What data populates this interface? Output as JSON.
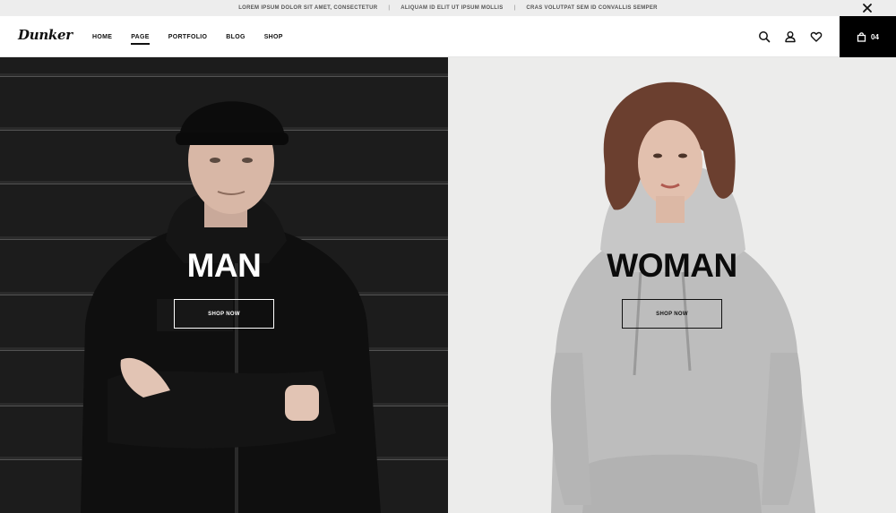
{
  "announcement": {
    "items": [
      "LOREM IPSUM DOLOR SIT AMET, CONSECTETUR",
      "ALIQUAM ID ELIT UT IPSUM MOLLIS",
      "CRAS VOLUTPAT SEM ID CONVALLIS SEMPER"
    ],
    "separator": "|",
    "close_icon": "close-icon"
  },
  "header": {
    "logo": "Dunker",
    "nav": [
      {
        "label": "HOME",
        "active": false
      },
      {
        "label": "PAGE",
        "active": true
      },
      {
        "label": "PORTFOLIO",
        "active": false
      },
      {
        "label": "BLOG",
        "active": false
      },
      {
        "label": "SHOP",
        "active": false
      }
    ],
    "icons": [
      "search-icon",
      "user-icon",
      "heart-icon"
    ],
    "cart": {
      "icon": "bag-icon",
      "count": "04"
    }
  },
  "hero": {
    "man": {
      "title": "MAN",
      "button": "SHOP NOW"
    },
    "woman": {
      "title": "WOMAN",
      "button": "SHOP NOW"
    }
  },
  "colors": {
    "topbar_bg": "#ededed",
    "cart_bg": "#000000",
    "man_bg": "#1a1a1a",
    "woman_bg": "#ececeb"
  }
}
